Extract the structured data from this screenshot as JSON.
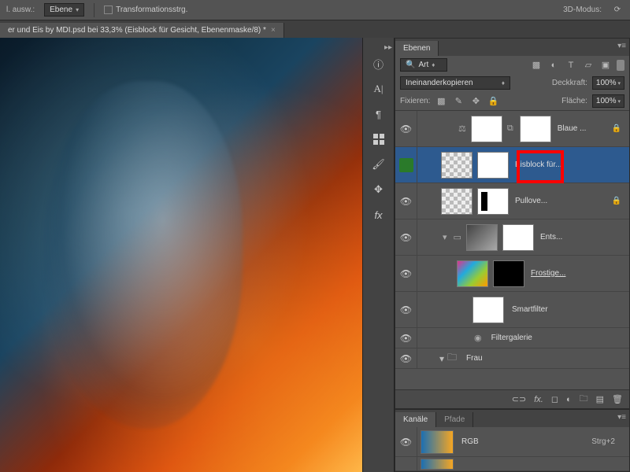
{
  "topbar": {
    "left_snip": "l. ausw.:",
    "dd1": "Ebene",
    "checkbox_label": "Transformationsstrg.",
    "right_label": "3D-Modus:"
  },
  "document_tab": {
    "title": "er und Eis by MDI.psd bei 33,3%  (Eisblock für Gesicht, Ebenenmaske/8) *"
  },
  "dock_icons": [
    "info",
    "type",
    "swatches",
    "brush",
    "clone",
    "history",
    "fx"
  ],
  "layers_panel": {
    "tab": "Ebenen",
    "filter_label": "Art",
    "blend_mode": "Ineinanderkopieren",
    "opacity_label": "Deckkraft:",
    "opacity_value": "100%",
    "lock_label": "Fixieren:",
    "fill_label": "Fläche:",
    "fill_value": "100%",
    "layers": [
      {
        "name": "Blaue ...",
        "indent": 2,
        "thumb": "white",
        "mask": "white",
        "locked": true,
        "chain": true,
        "balance": true
      },
      {
        "name": "Eisblock für...",
        "indent": 1,
        "thumb": "trans",
        "mask": "white",
        "selected": true,
        "green": true,
        "highlight": true
      },
      {
        "name": "Pullove...",
        "indent": 1,
        "thumb": "trans",
        "mask": "bw",
        "locked": true
      },
      {
        "name": "Ents...",
        "indent": 1,
        "thumb": "gray",
        "mask": "white",
        "chain_small": true
      },
      {
        "name": "Frostige...",
        "indent": 2,
        "thumb": "color",
        "mask": "dark",
        "underline": true
      },
      {
        "name": "Smartfilter",
        "indent": 3,
        "thumb": "white",
        "short": false
      },
      {
        "name": "Filtergalerie",
        "indent": 3,
        "short": true,
        "toggle": true
      },
      {
        "name": "Frau",
        "indent": 1,
        "short": true,
        "folder": true
      }
    ]
  },
  "channels_panel": {
    "tab1": "Kanäle",
    "tab2": "Pfade",
    "channels": [
      {
        "name": "RGB",
        "shortcut": "Strg+2"
      }
    ]
  }
}
